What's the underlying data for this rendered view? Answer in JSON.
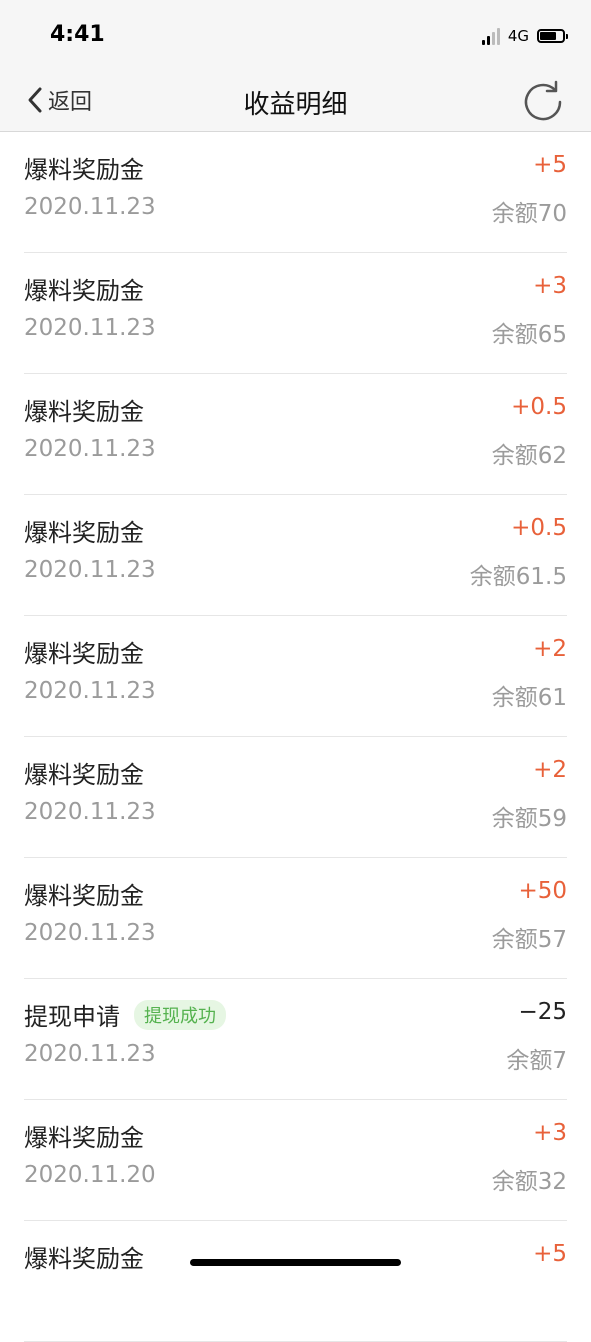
{
  "status_bar": {
    "time": "4:41",
    "network": "4G"
  },
  "nav": {
    "back_label": "返回",
    "title": "收益明细",
    "refresh_icon": "refresh-icon"
  },
  "colors": {
    "positive_amount": "#e8613a",
    "negative_amount": "#222222",
    "badge_text": "#55b24f",
    "badge_bg": "#e6f6e3"
  },
  "records": [
    {
      "title": "爆料奖励金",
      "badge": "",
      "date": "2020.11.23",
      "amount": "+5",
      "balance": "余额70",
      "type": "income"
    },
    {
      "title": "爆料奖励金",
      "badge": "",
      "date": "2020.11.23",
      "amount": "+3",
      "balance": "余额65",
      "type": "income"
    },
    {
      "title": "爆料奖励金",
      "badge": "",
      "date": "2020.11.23",
      "amount": "+0.5",
      "balance": "余额62",
      "type": "income"
    },
    {
      "title": "爆料奖励金",
      "badge": "",
      "date": "2020.11.23",
      "amount": "+0.5",
      "balance": "余额61.5",
      "type": "income"
    },
    {
      "title": "爆料奖励金",
      "badge": "",
      "date": "2020.11.23",
      "amount": "+2",
      "balance": "余额61",
      "type": "income"
    },
    {
      "title": "爆料奖励金",
      "badge": "",
      "date": "2020.11.23",
      "amount": "+2",
      "balance": "余额59",
      "type": "income"
    },
    {
      "title": "爆料奖励金",
      "badge": "",
      "date": "2020.11.23",
      "amount": "+50",
      "balance": "余额57",
      "type": "income"
    },
    {
      "title": "提现申请",
      "badge": "提现成功",
      "date": "2020.11.23",
      "amount": "−25",
      "balance": "余额7",
      "type": "withdraw"
    },
    {
      "title": "爆料奖励金",
      "badge": "",
      "date": "2020.11.20",
      "amount": "+3",
      "balance": "余额32",
      "type": "income"
    },
    {
      "title": "爆料奖励金",
      "badge": "",
      "date": "",
      "amount": "+5",
      "balance": "",
      "type": "income"
    }
  ]
}
